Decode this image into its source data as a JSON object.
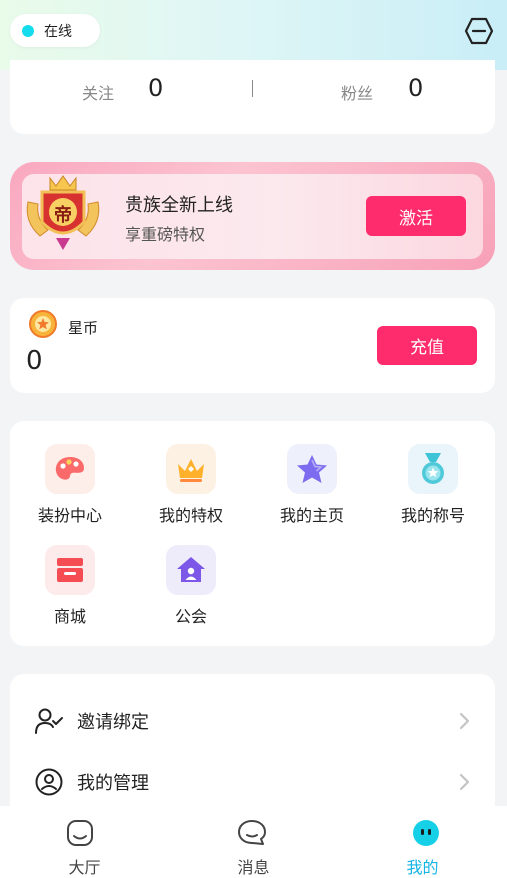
{
  "status": {
    "text": "在线",
    "dot_color": "#14dced"
  },
  "header": {
    "exit_icon": "exit-hexagon-icon"
  },
  "stats": {
    "follow_label": "关注",
    "follow_value": "0",
    "divider": "|",
    "fans_label": "粉丝",
    "fans_value": "0"
  },
  "vip": {
    "badge_text": "帝",
    "title": "贵族全新上线",
    "subtitle": "享重磅特权",
    "activate_label": "激活"
  },
  "coins": {
    "label": "星币",
    "value": "0",
    "recharge_label": "充值",
    "icon": "star-coin-icon"
  },
  "features": [
    {
      "label": "装扮中心",
      "icon": "palette-icon"
    },
    {
      "label": "我的特权",
      "icon": "crown-icon"
    },
    {
      "label": "我的主页",
      "icon": "star-icon"
    },
    {
      "label": "我的称号",
      "icon": "medal-icon"
    },
    {
      "label": "商城",
      "icon": "shop-icon"
    },
    {
      "label": "公会",
      "icon": "guild-house-icon"
    }
  ],
  "menu": [
    {
      "label": "邀请绑定",
      "icon": "user-check-icon"
    },
    {
      "label": "我的管理",
      "icon": "user-circle-icon"
    }
  ],
  "tabs": [
    {
      "label": "大厅",
      "icon": "hall-icon",
      "active": false
    },
    {
      "label": "消息",
      "icon": "message-icon",
      "active": false
    },
    {
      "label": "我的",
      "icon": "mine-face-icon",
      "active": true
    }
  ],
  "colors": {
    "accent": "#fe2c6c",
    "tab_active": "#14b4e6"
  }
}
